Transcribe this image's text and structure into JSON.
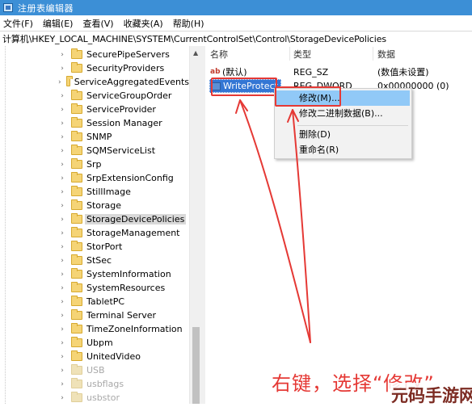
{
  "window": {
    "title": "注册表编辑器"
  },
  "menu": [
    "文件(F)",
    "编辑(E)",
    "查看(V)",
    "收藏夹(A)",
    "帮助(H)"
  ],
  "address": "计算机\\HKEY_LOCAL_MACHINE\\SYSTEM\\CurrentControlSet\\Control\\StorageDevicePolicies",
  "tree": [
    {
      "label": "SecurePipeServers",
      "state": "normal"
    },
    {
      "label": "SecurityProviders",
      "state": "normal"
    },
    {
      "label": "ServiceAggregatedEvents",
      "state": "normal"
    },
    {
      "label": "ServiceGroupOrder",
      "state": "normal"
    },
    {
      "label": "ServiceProvider",
      "state": "normal"
    },
    {
      "label": "Session Manager",
      "state": "normal"
    },
    {
      "label": "SNMP",
      "state": "normal"
    },
    {
      "label": "SQMServiceList",
      "state": "normal"
    },
    {
      "label": "Srp",
      "state": "normal"
    },
    {
      "label": "SrpExtensionConfig",
      "state": "normal"
    },
    {
      "label": "StillImage",
      "state": "normal"
    },
    {
      "label": "Storage",
      "state": "normal"
    },
    {
      "label": "StorageDevicePolicies",
      "state": "selected"
    },
    {
      "label": "StorageManagement",
      "state": "normal"
    },
    {
      "label": "StorPort",
      "state": "normal"
    },
    {
      "label": "StSec",
      "state": "normal"
    },
    {
      "label": "SystemInformation",
      "state": "normal"
    },
    {
      "label": "SystemResources",
      "state": "normal"
    },
    {
      "label": "TabletPC",
      "state": "normal"
    },
    {
      "label": "Terminal Server",
      "state": "normal"
    },
    {
      "label": "TimeZoneInformation",
      "state": "normal"
    },
    {
      "label": "Ubpm",
      "state": "normal"
    },
    {
      "label": "UnitedVideo",
      "state": "normal"
    },
    {
      "label": "USB",
      "state": "dim"
    },
    {
      "label": "usbflags",
      "state": "dim"
    },
    {
      "label": "usbstor",
      "state": "dim"
    }
  ],
  "columns": {
    "name": "名称",
    "type": "类型",
    "data": "数据"
  },
  "values": [
    {
      "name": "(默认)",
      "type": "REG_SZ",
      "data": "(数值未设置)",
      "icon": "string-value-icon"
    },
    {
      "name": "WriteProtect",
      "type": "REG_DWORD",
      "data": "0x00000000 (0)",
      "icon": "binary-value-icon"
    }
  ],
  "context_menu": {
    "modify": "修改(M)...",
    "modify_binary": "修改二进制数据(B)...",
    "delete": "删除(D)",
    "rename": "重命名(R)"
  },
  "annotation": {
    "caption": "右键，选择“修改”",
    "color": "#e53935"
  },
  "watermark": "元码手游网"
}
